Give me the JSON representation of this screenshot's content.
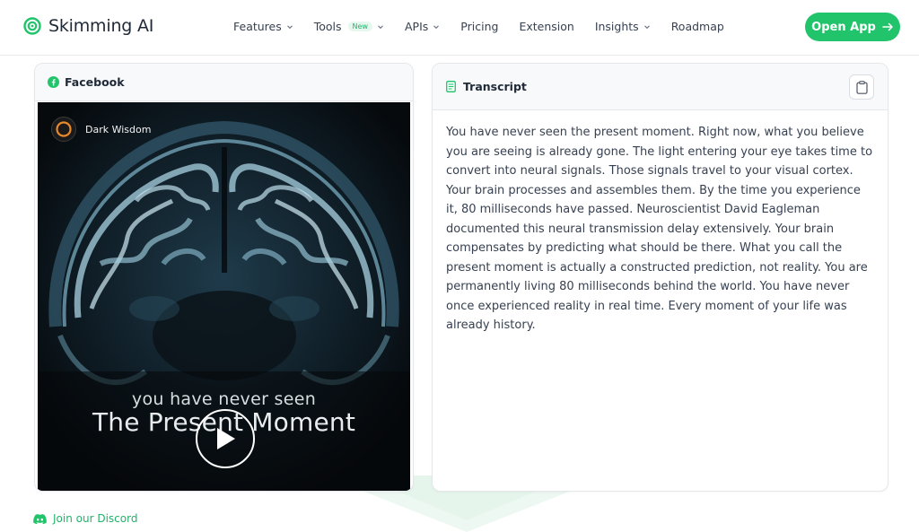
{
  "brand": {
    "name": "Skimming AI",
    "accent": "#22c46b"
  },
  "nav": {
    "items": [
      {
        "label": "Features",
        "has_dropdown": true
      },
      {
        "label": "Tools",
        "badge": "New",
        "has_dropdown": true
      },
      {
        "label": "APIs",
        "has_dropdown": true
      },
      {
        "label": "Pricing",
        "has_dropdown": false
      },
      {
        "label": "Extension",
        "has_dropdown": false
      },
      {
        "label": "Insights",
        "has_dropdown": true
      },
      {
        "label": "Roadmap",
        "has_dropdown": false
      }
    ],
    "cta_label": "Open App"
  },
  "video": {
    "source_label": "Facebook",
    "channel_name": "Dark Wisdom",
    "caption_small": "you have never seen",
    "caption_big": "The Present Moment"
  },
  "transcript": {
    "title": "Transcript",
    "text": "You have never seen the present moment. Right now, what you believe you are seeing is already gone. The light entering your eye takes time to convert into neural signals. Those signals travel to your visual cortex. Your brain processes and assembles them. By the time you experience it, 80 milliseconds have passed. Neuroscientist David Eagleman documented this neural transmission delay extensively. Your brain compensates by predicting what should be there. What you call the present moment is actually a constructed prediction, not reality. You are permanently living 80 milliseconds behind the world. You have never once experienced reality in real time. Every moment of your life was already history."
  },
  "footer": {
    "discord_label": "Join our Discord"
  }
}
